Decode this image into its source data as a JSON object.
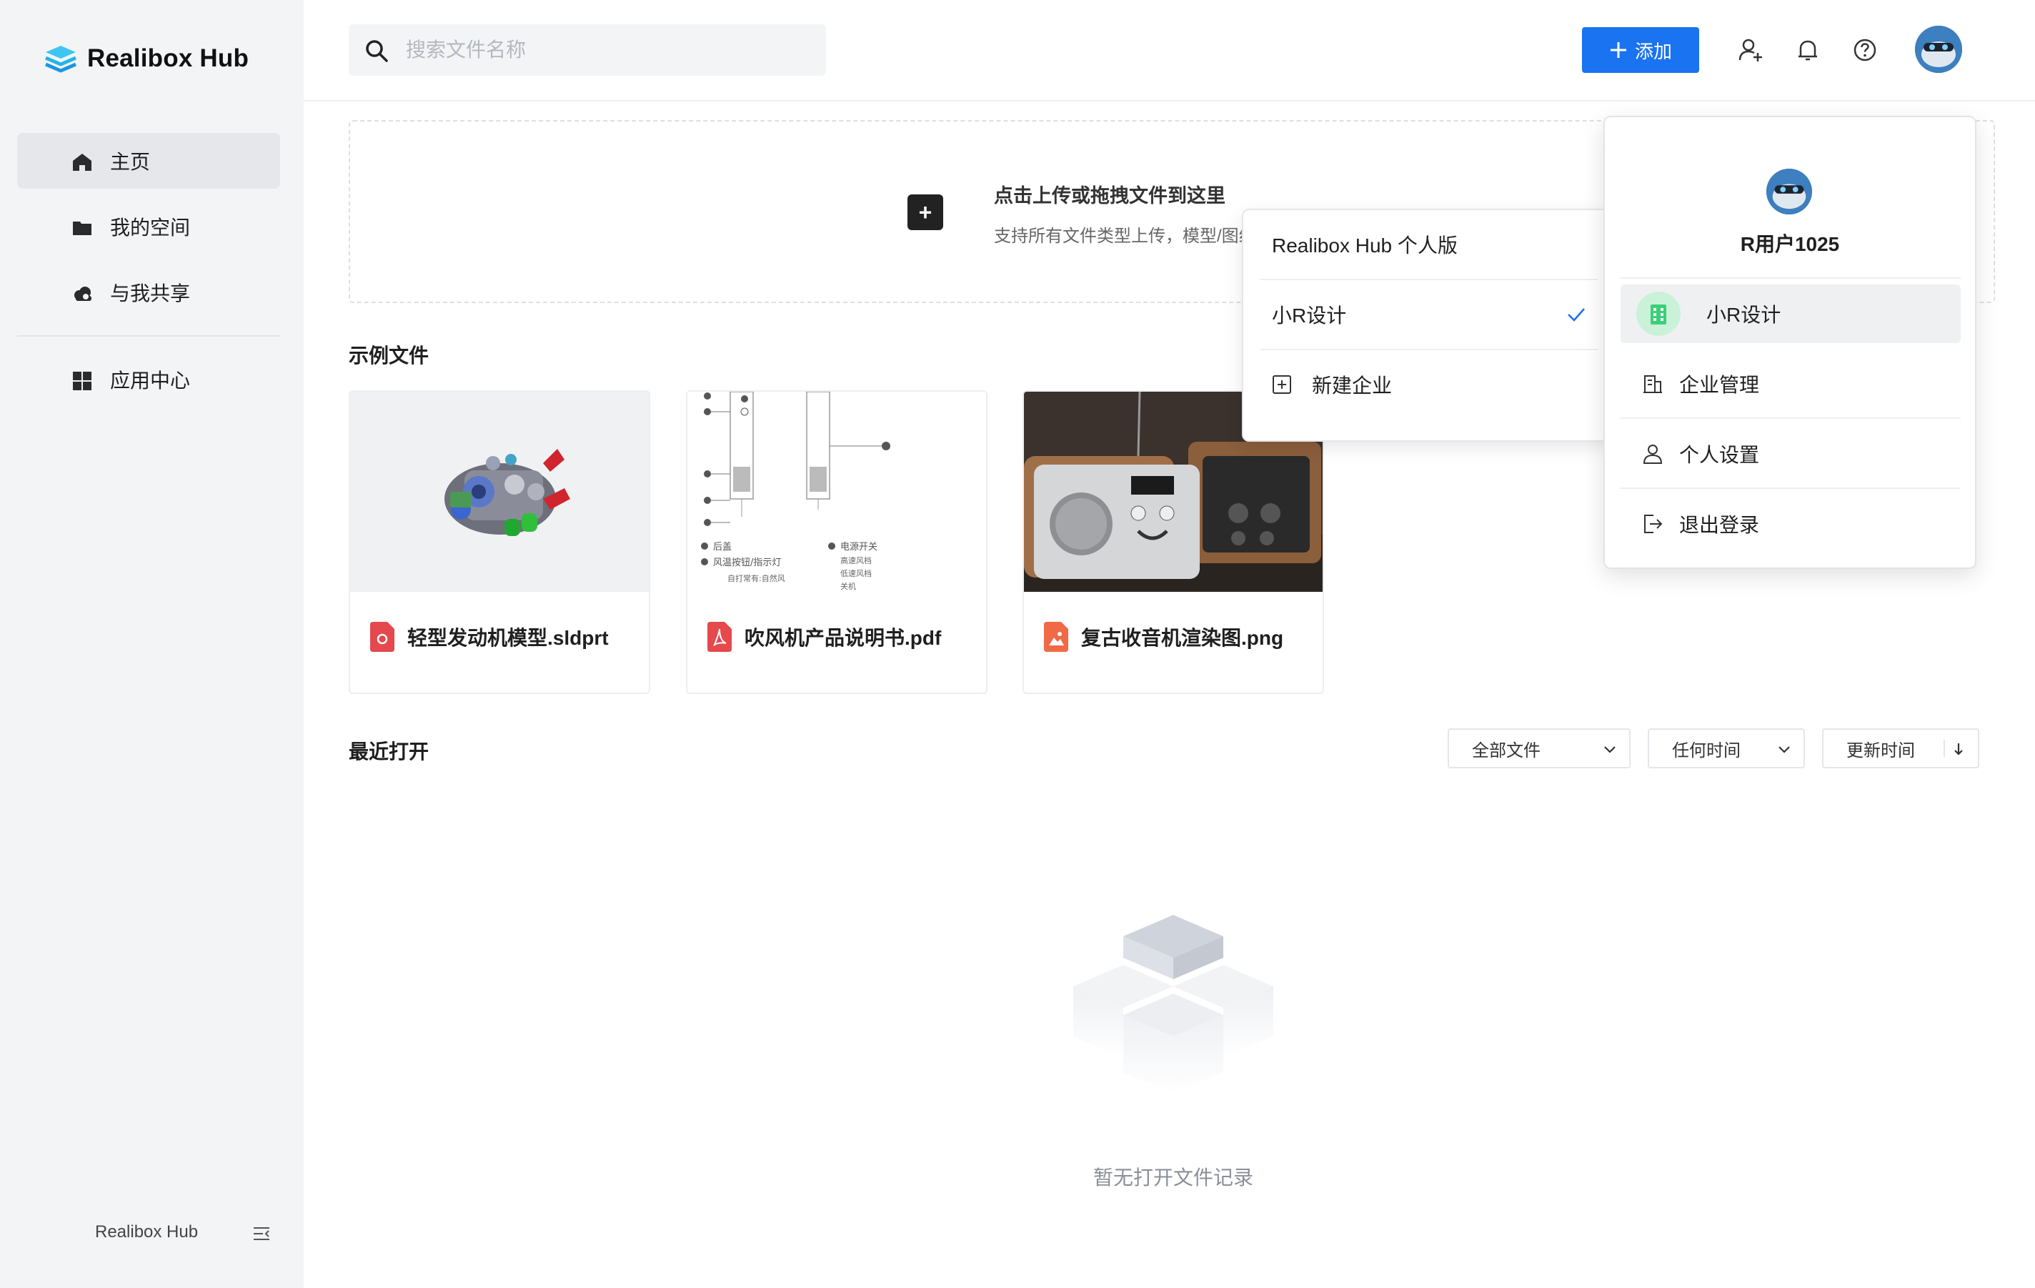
{
  "app": {
    "name": "Realibox Hub"
  },
  "sidebar": {
    "items": [
      {
        "label": "主页",
        "icon": "home-icon",
        "active": true
      },
      {
        "label": "我的空间",
        "icon": "folder-icon",
        "active": false
      },
      {
        "label": "与我共享",
        "icon": "cloud-share-icon",
        "active": false
      },
      {
        "label": "应用中心",
        "icon": "apps-grid-icon",
        "active": false
      }
    ],
    "footer_brand": "Realibox Hub"
  },
  "header": {
    "search": {
      "placeholder": "搜索文件名称",
      "value": ""
    },
    "add_label": "添加",
    "icons": [
      "add-user-icon",
      "bell-icon",
      "help-icon",
      "avatar"
    ]
  },
  "upload": {
    "title": "点击上传或拖拽文件到这里",
    "subtitle": "支持所有文件类型上传，模型/图纸"
  },
  "examples": {
    "title": "示例文件",
    "files": [
      {
        "name": "轻型发动机模型.sldprt",
        "type": "cad",
        "icon_color": "#e5484d"
      },
      {
        "name": "吹风机产品说明书.pdf",
        "type": "pdf",
        "icon_color": "#e5484d"
      },
      {
        "name": "复古收音机渲染图.png",
        "type": "image",
        "icon_color": "#f06a45"
      }
    ],
    "pdf_labels": {
      "l1": "后盖",
      "l2": "风温按钮/指示灯",
      "l3": "自打常有:自然风",
      "r1": "电源开关",
      "r2": "高速风档",
      "r3": "低速风档",
      "r4": "关机"
    }
  },
  "recent": {
    "title": "最近打开",
    "filters": {
      "type": "全部文件",
      "time": "任何时间",
      "sort": "更新时间"
    },
    "empty": "暂无打开文件记录"
  },
  "org_dropdown": {
    "items": [
      {
        "label": "Realibox Hub 个人版",
        "checked": false
      },
      {
        "label": "小R设计",
        "checked": true
      }
    ],
    "new_label": "新建企业"
  },
  "profile_panel": {
    "username": "R用户1025",
    "current_org": "小R设计",
    "items": [
      {
        "label": "企业管理",
        "icon": "enterprise-icon"
      },
      {
        "label": "个人设置",
        "icon": "user-icon"
      },
      {
        "label": "退出登录",
        "icon": "logout-icon"
      }
    ]
  },
  "colors": {
    "accent": "#1a73f0",
    "sidebar_bg": "#f3f4f6",
    "org_badge": "#3ccf7a"
  }
}
